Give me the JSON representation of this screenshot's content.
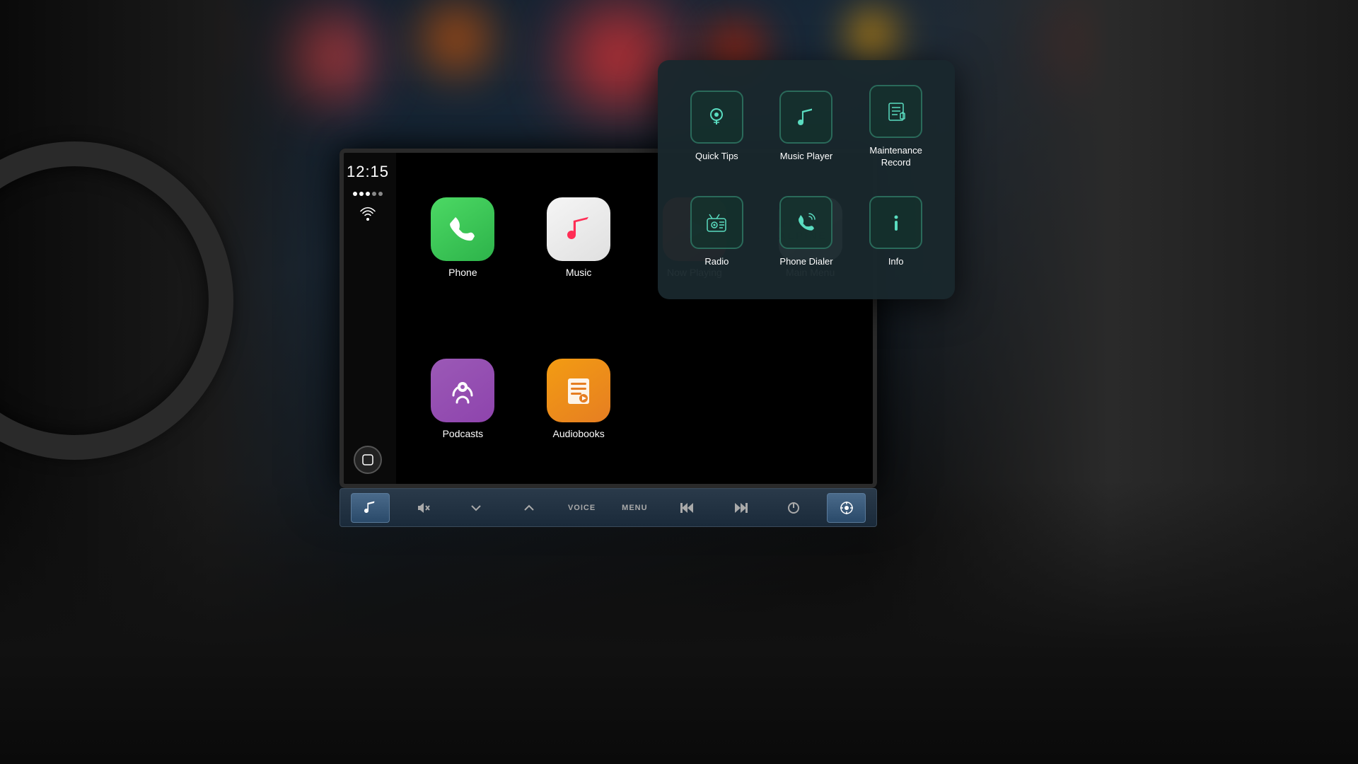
{
  "background": {
    "description": "Car interior bokeh background"
  },
  "screen": {
    "time": "12:15",
    "apps": [
      {
        "id": "phone",
        "label": "Phone",
        "icon": "📞",
        "iconType": "phone"
      },
      {
        "id": "music",
        "label": "Music",
        "icon": "🎵",
        "iconType": "music"
      },
      {
        "id": "nowplaying",
        "label": "Now Playing",
        "icon": "▶",
        "iconType": "nowplaying"
      },
      {
        "id": "mainmenu",
        "label": "Main Menu",
        "icon": "🏔",
        "iconType": "mainmenu"
      },
      {
        "id": "podcasts",
        "label": "Podcasts",
        "icon": "🎙",
        "iconType": "podcasts"
      },
      {
        "id": "audiobooks",
        "label": "Audiobooks",
        "icon": "📚",
        "iconType": "audiobooks"
      }
    ]
  },
  "controlBar": {
    "buttons": [
      {
        "id": "music-mode",
        "label": "♪",
        "active": true
      },
      {
        "id": "mute",
        "label": "🔇",
        "active": false
      },
      {
        "id": "down",
        "label": "∨",
        "active": false
      },
      {
        "id": "up",
        "label": "∧",
        "active": false
      },
      {
        "id": "voice",
        "label": "VOICE",
        "active": false,
        "isText": true
      },
      {
        "id": "menu",
        "label": "MENU",
        "active": false,
        "isText": true
      },
      {
        "id": "prev",
        "label": "⏮",
        "active": false
      },
      {
        "id": "next",
        "label": "⏭",
        "active": false
      },
      {
        "id": "power",
        "label": "⏻",
        "active": false
      },
      {
        "id": "nav",
        "label": "◎",
        "active": true
      }
    ]
  },
  "popupMenu": {
    "items": [
      {
        "id": "quick-tips",
        "label": "Quick Tips",
        "icon": "💡"
      },
      {
        "id": "music-player",
        "label": "Music Player",
        "icon": "♪"
      },
      {
        "id": "maintenance-record",
        "label": "Maintenance Record",
        "icon": "⚙"
      },
      {
        "id": "radio",
        "label": "Radio",
        "icon": "📺"
      },
      {
        "id": "phone-dialer",
        "label": "Phone Dialer",
        "icon": "📞"
      },
      {
        "id": "info",
        "label": "Info",
        "icon": "ℹ"
      }
    ]
  }
}
